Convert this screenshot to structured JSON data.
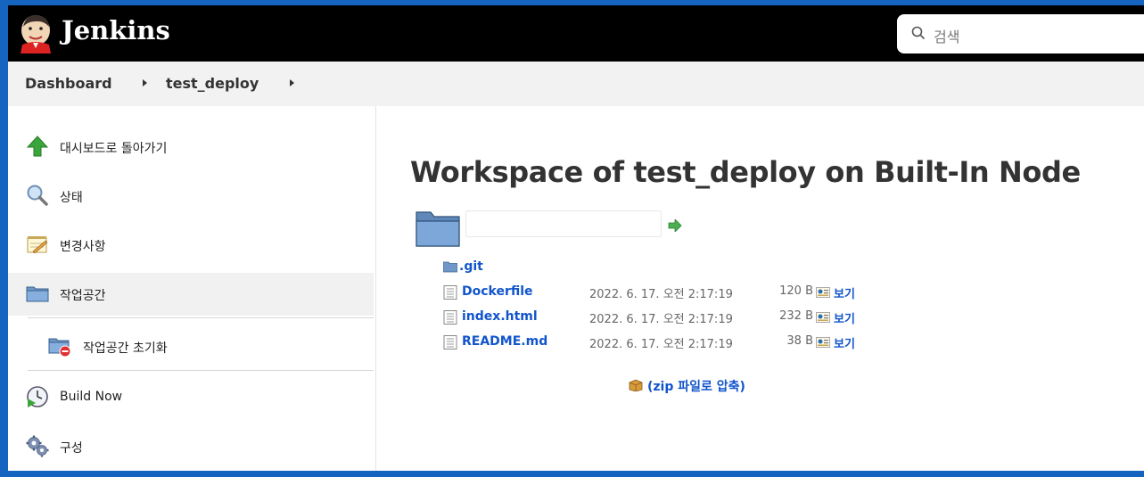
{
  "header": {
    "brand": "Jenkins",
    "search_placeholder": "검색"
  },
  "breadcrumb": {
    "items": [
      "Dashboard",
      "test_deploy"
    ]
  },
  "sidebar": {
    "items": [
      {
        "label": "대시보드로 돌아가기",
        "icon": "up-arrow-icon"
      },
      {
        "label": "상태",
        "icon": "magnifier-icon"
      },
      {
        "label": "변경사항",
        "icon": "notepad-icon"
      },
      {
        "label": "작업공간",
        "icon": "folder-icon",
        "active": true
      },
      {
        "label": "작업공간 초기화",
        "icon": "folder-delete-icon"
      },
      {
        "label": "Build Now",
        "icon": "clock-play-icon"
      },
      {
        "label": "구성",
        "icon": "gear-icon"
      }
    ]
  },
  "main": {
    "title": "Workspace of test_deploy on Built-In Node",
    "path_value": "",
    "files": [
      {
        "name": ".git",
        "type": "folder"
      },
      {
        "name": "Dockerfile",
        "type": "file",
        "date": "2022. 6. 17. 오전 2:17:19",
        "size": "120 B",
        "view": "보기"
      },
      {
        "name": "index.html",
        "type": "file",
        "date": "2022. 6. 17. 오전 2:17:19",
        "size": "232 B",
        "view": "보기"
      },
      {
        "name": "README.md",
        "type": "file",
        "date": "2022. 6. 17. 오전 2:17:19",
        "size": "38 B",
        "view": "보기"
      }
    ],
    "zip_label": "(zip 파일로 압축)"
  },
  "colors": {
    "page_border": "#1565c0",
    "header_bg": "#000000",
    "link": "#1155cc",
    "breadcrumb_bg": "#f2f2f2"
  }
}
